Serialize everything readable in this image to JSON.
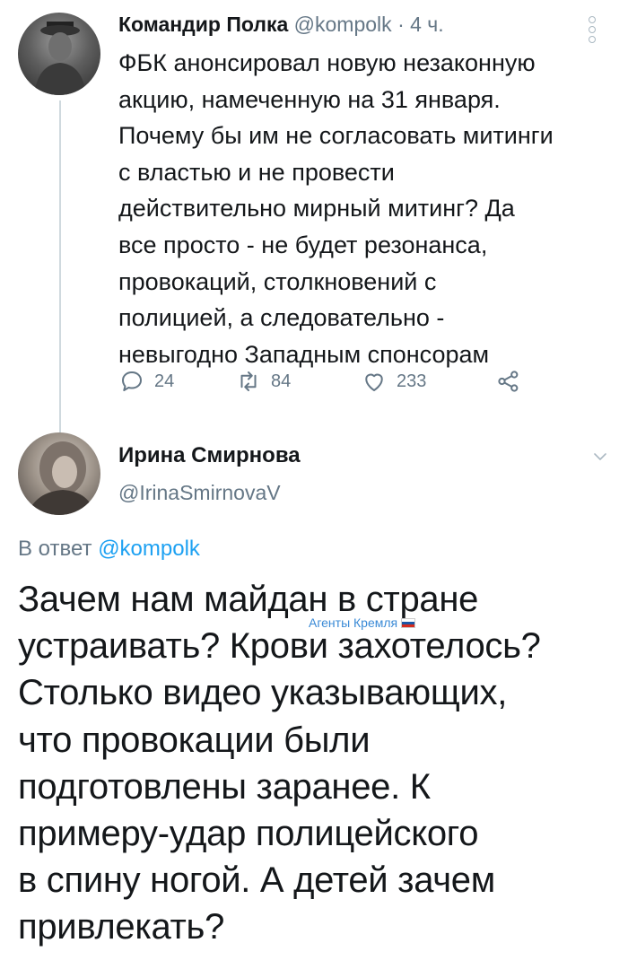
{
  "tweet1": {
    "author_name": "Командир Полка",
    "handle": "@kompolk",
    "time": "· 4 ч.",
    "body_lines": [
      "ФБК анонсировал новую незаконную",
      "акцию, намеченную на 31 января.",
      "Почему бы им не согласовать митинги",
      "с властью и не провести",
      "действительно мирный митинг? Да",
      "все просто - не будет резонанса,",
      "провокаций, столкновений с",
      "полицией, а следовательно -",
      "невыгодно Западным спонсорам"
    ],
    "replies": "24",
    "retweets": "84",
    "likes": "233"
  },
  "tweet2": {
    "author_name": "Ирина Смирнова",
    "handle": "@IrinaSmirnovaV",
    "reply_prefix": "В ответ",
    "reply_mention": "@kompolk",
    "body_lines": [
      "Зачем нам майдан в стране",
      "устраивать? Крови захотелось?",
      "Столько видео указывающих,",
      "что провокации были",
      "подготовлены заранее. К",
      "примеру-удар полицейского",
      "в спину ногой. А детей зачем",
      "привлекать?"
    ]
  },
  "watermark": "Агенты Кремля",
  "colors": {
    "link": "#1da1f2",
    "muted": "#657786",
    "text": "#14171a"
  }
}
